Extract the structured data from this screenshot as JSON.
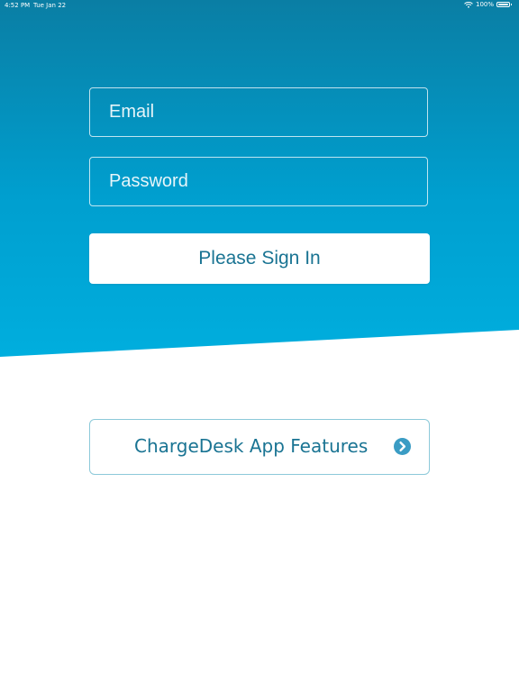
{
  "status_bar": {
    "time": "4:52 PM",
    "date": "Tue Jan 22",
    "battery": "100%",
    "wifi_icon": "wifi-icon",
    "battery_icon": "battery-icon",
    "battery_level": 1.0
  },
  "login": {
    "email_placeholder": "Email",
    "email_value": "",
    "password_placeholder": "Password",
    "password_value": "",
    "sign_in_label": "Please Sign In"
  },
  "features": {
    "label": "ChargeDesk App Features",
    "icon": "chevron-right-circle-icon"
  },
  "colors": {
    "hero_top": "#0a7ea4",
    "hero_bottom": "#00aede",
    "button_text": "#1a7493",
    "features_border": "#8cc9d9",
    "icon_fill": "#3a9cc4"
  }
}
